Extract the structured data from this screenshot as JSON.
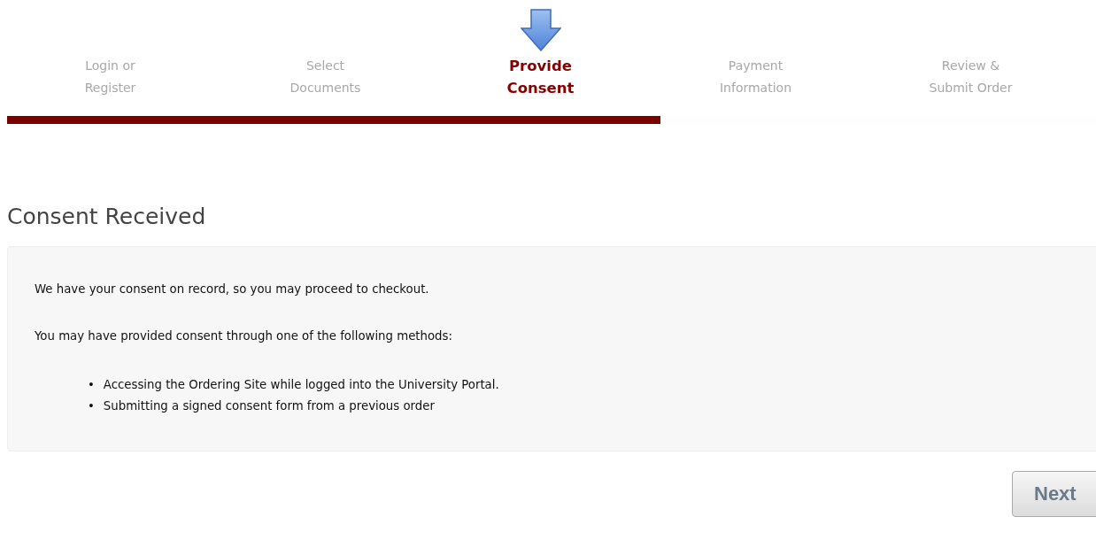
{
  "steps": [
    {
      "label": "Login or\nRegister",
      "selected": false
    },
    {
      "label": "Select\nDocuments",
      "selected": false
    },
    {
      "label": "Provide\nConsent",
      "selected": true
    },
    {
      "label": "Payment\nInformation",
      "selected": false
    },
    {
      "label": "Review &\nSubmit Order",
      "selected": false
    }
  ],
  "progress": {
    "level": 0.6
  },
  "heading": "Consent Received",
  "panel": {
    "paragraphs": [
      "We have your consent on record, so you may proceed to checkout.",
      "You may have provided consent through one of the following methods:"
    ],
    "items": [
      {
        "bullet": "•",
        "text": "Accessing the Ordering Site while logged into the University Portal."
      },
      {
        "bullet": "•",
        "text": "Submitting a signed consent form from a previous order"
      }
    ]
  },
  "buttons": [
    {
      "label": "Next"
    }
  ]
}
